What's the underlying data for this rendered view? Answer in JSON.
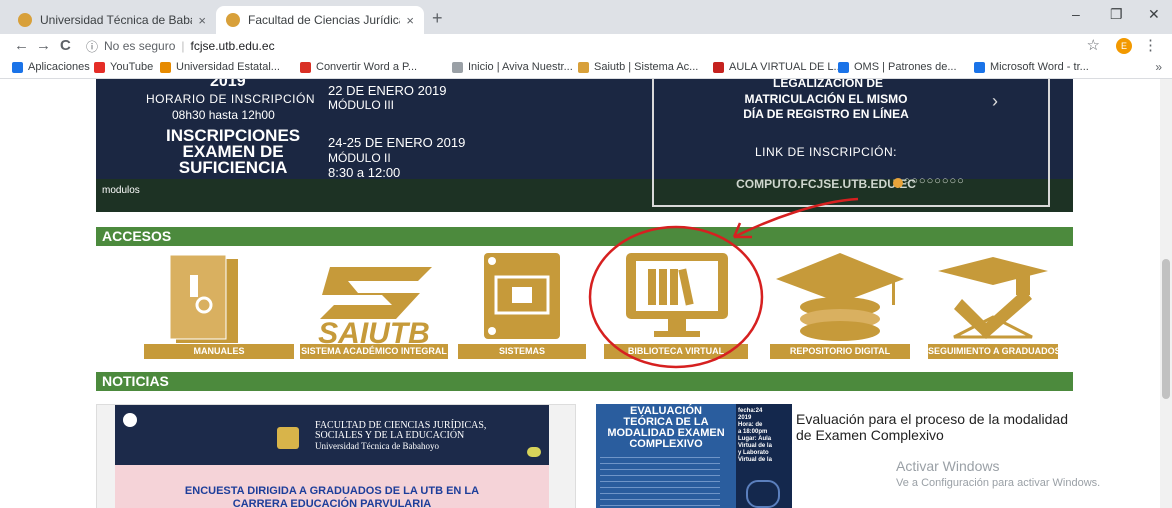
{
  "browser": {
    "tabs": [
      {
        "title": "Universidad Técnica de Babahoyo",
        "close": "×"
      },
      {
        "title": "Facultad de Ciencias Jurídicas, So",
        "close": "×"
      }
    ],
    "new_tab": "+",
    "window_controls": {
      "minimize": "–",
      "restore": "❐",
      "close": "✕"
    },
    "nav": {
      "back": "←",
      "forward": "→",
      "reload": "C"
    },
    "address": {
      "info": "ⓘ",
      "security_text": "No es seguro",
      "separator": "|",
      "url": "fcjse.utb.edu.ec"
    },
    "profile_initial": "E",
    "bookmarks": [
      {
        "label": "Aplicaciones",
        "color": "#1a73e8"
      },
      {
        "label": "YouTube",
        "color": "#e52d27"
      },
      {
        "label": "Universidad Estatal...",
        "color": "#e68a00"
      },
      {
        "label": "Convertir Word a P...",
        "color": "#d93025"
      },
      {
        "label": "Inicio | Aviva Nuestr...",
        "color": "#9aa0a6"
      },
      {
        "label": "Saiutb | Sistema Ac...",
        "color": "#d8a03a"
      },
      {
        "label": "AULA VIRTUAL DE L...",
        "color": "#c5221f"
      },
      {
        "label": "OMS | Patrones de...",
        "color": "#1a73e8"
      },
      {
        "label": "Microsoft Word - tr...",
        "color": "#1a73e8"
      }
    ],
    "bookmarks_more": "»"
  },
  "banner": {
    "year": "2019",
    "horario_label": "HORARIO DE INSCRIPCIÓN",
    "horario_time": "08h30 hasta 12h00",
    "date1": "22 DE ENERO 2019",
    "module1": "MÓDULO III",
    "inscripciones": [
      "INSCRIPCIONES",
      "EXAMEN DE",
      "SUFICIENCIA"
    ],
    "date2": "24-25 DE ENERO 2019",
    "module2": "MÓDULO II",
    "time2": "8:30 a 12:00",
    "modulos": "modulos",
    "right_text": [
      "LEGALIZACIÓN DE",
      "MATRICULACIÓN EL MISMO",
      "DÍA DE REGISTRO EN LÍNEA"
    ],
    "link_label": "LINK DE INSCRIPCIÓN:",
    "link_url": "COMPUTO.FCJSE.UTB.EDU.EC",
    "next": "›",
    "dots": "○○○○○○○○○"
  },
  "accesos": {
    "title": "ACCESOS",
    "items": [
      {
        "label": "MANUALES"
      },
      {
        "label": "SISTEMA ACADÉMICO INTEGRAL",
        "logo": "SAIUTB"
      },
      {
        "label": "SISTEMAS"
      },
      {
        "label": "BIBLIOTECA VIRTUAL"
      },
      {
        "label": "REPOSITORIO DIGITAL"
      },
      {
        "label": "SEGUIMIENTO A GRADUADOS"
      }
    ]
  },
  "noticias": {
    "title": "NOTICIAS",
    "card1": {
      "faculty": [
        "FACULTAD DE CIENCIAS JURÍDICAS,",
        "SOCIALES Y DE LA EDUCACIÓN",
        "Universidad Técnica de Babahoyo"
      ],
      "headline": [
        "ENCUESTA DIRIGIDA A GRADUADOS DE LA UTB EN LA",
        "CARRERA EDUCACIÓN PARVULARIA"
      ]
    },
    "card2": {
      "poster_title": [
        "EVALUACIÓN",
        "TEÓRICA DE LA",
        "MODALIDAD EXAMEN",
        "COMPLEXIVO"
      ],
      "poster_side": [
        "fecha:24",
        "2019",
        "Hora: de",
        "a 18:00pm",
        "Lugar: Aula",
        "Virtual de la",
        "y Laborato",
        "Virtual de la"
      ],
      "headline": "Evaluación para el proceso de la modalidad de Examen Complexivo"
    }
  },
  "windows_watermark": {
    "title": "Activar Windows",
    "subtitle": "Ve a Configuración para activar Windows."
  },
  "colors": {
    "accent_gold": "#c69a3a",
    "section_green": "#4c8a3d",
    "annotation_red": "#d62020"
  }
}
